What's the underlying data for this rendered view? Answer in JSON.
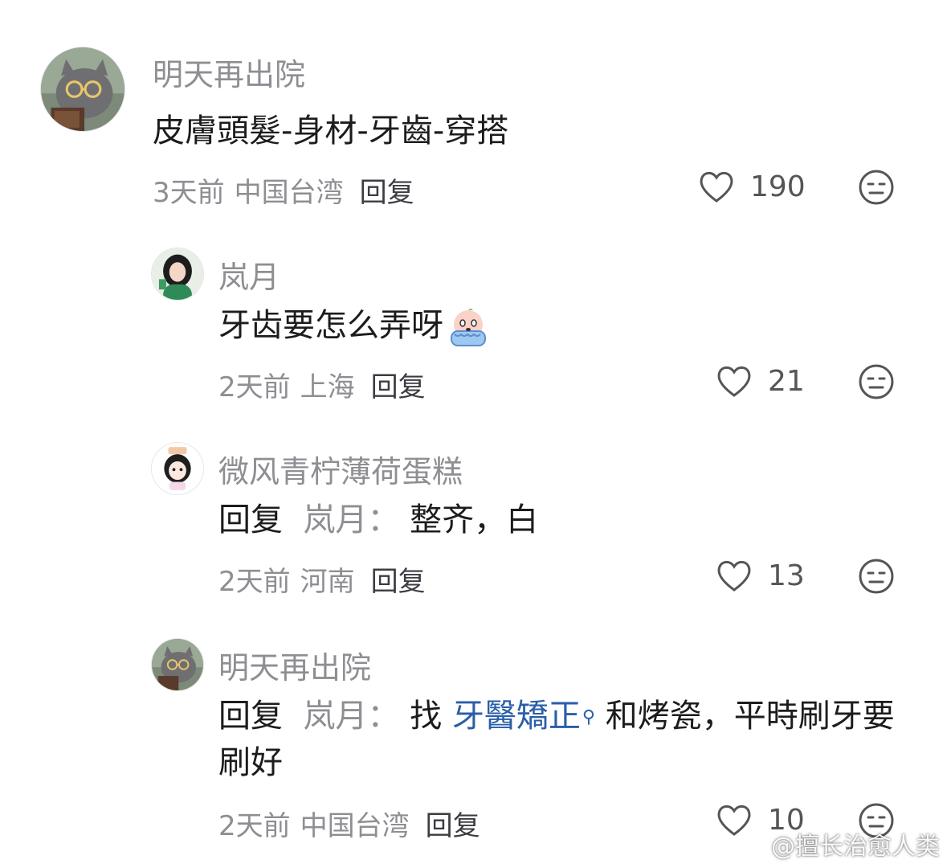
{
  "comments": [
    {
      "name": "明天再出院",
      "text": "皮膚頭髮-身材-牙齒-穿搭",
      "time": "3天前",
      "location": "中国台湾",
      "reply": "回复",
      "likes": "190"
    },
    {
      "name": "岚月",
      "text": "牙齿要怎么弄呀",
      "emoji": "crying-emoji",
      "time": "2天前",
      "location": "上海",
      "reply": "回复",
      "likes": "21"
    },
    {
      "name": "微风青柠薄荷蛋糕",
      "reply_prefix": "回复",
      "reply_target": "岚月：",
      "text": "整齐，白",
      "time": "2天前",
      "location": "河南",
      "reply": "回复",
      "likes": "13"
    },
    {
      "name": "明天再出院",
      "reply_prefix": "回复",
      "reply_target": "岚月：",
      "text_before": "找 ",
      "link": "牙醫矯正",
      "text_after": "和烤瓷，平時刷牙要刷好",
      "time": "2天前",
      "location": "中国台湾",
      "reply": "回复",
      "likes": "10"
    }
  ],
  "watermark": "@擅长治愈人类",
  "colors": {
    "meta": "#8e8e93",
    "text": "#1c1c1e",
    "link": "#2a5ea8"
  }
}
